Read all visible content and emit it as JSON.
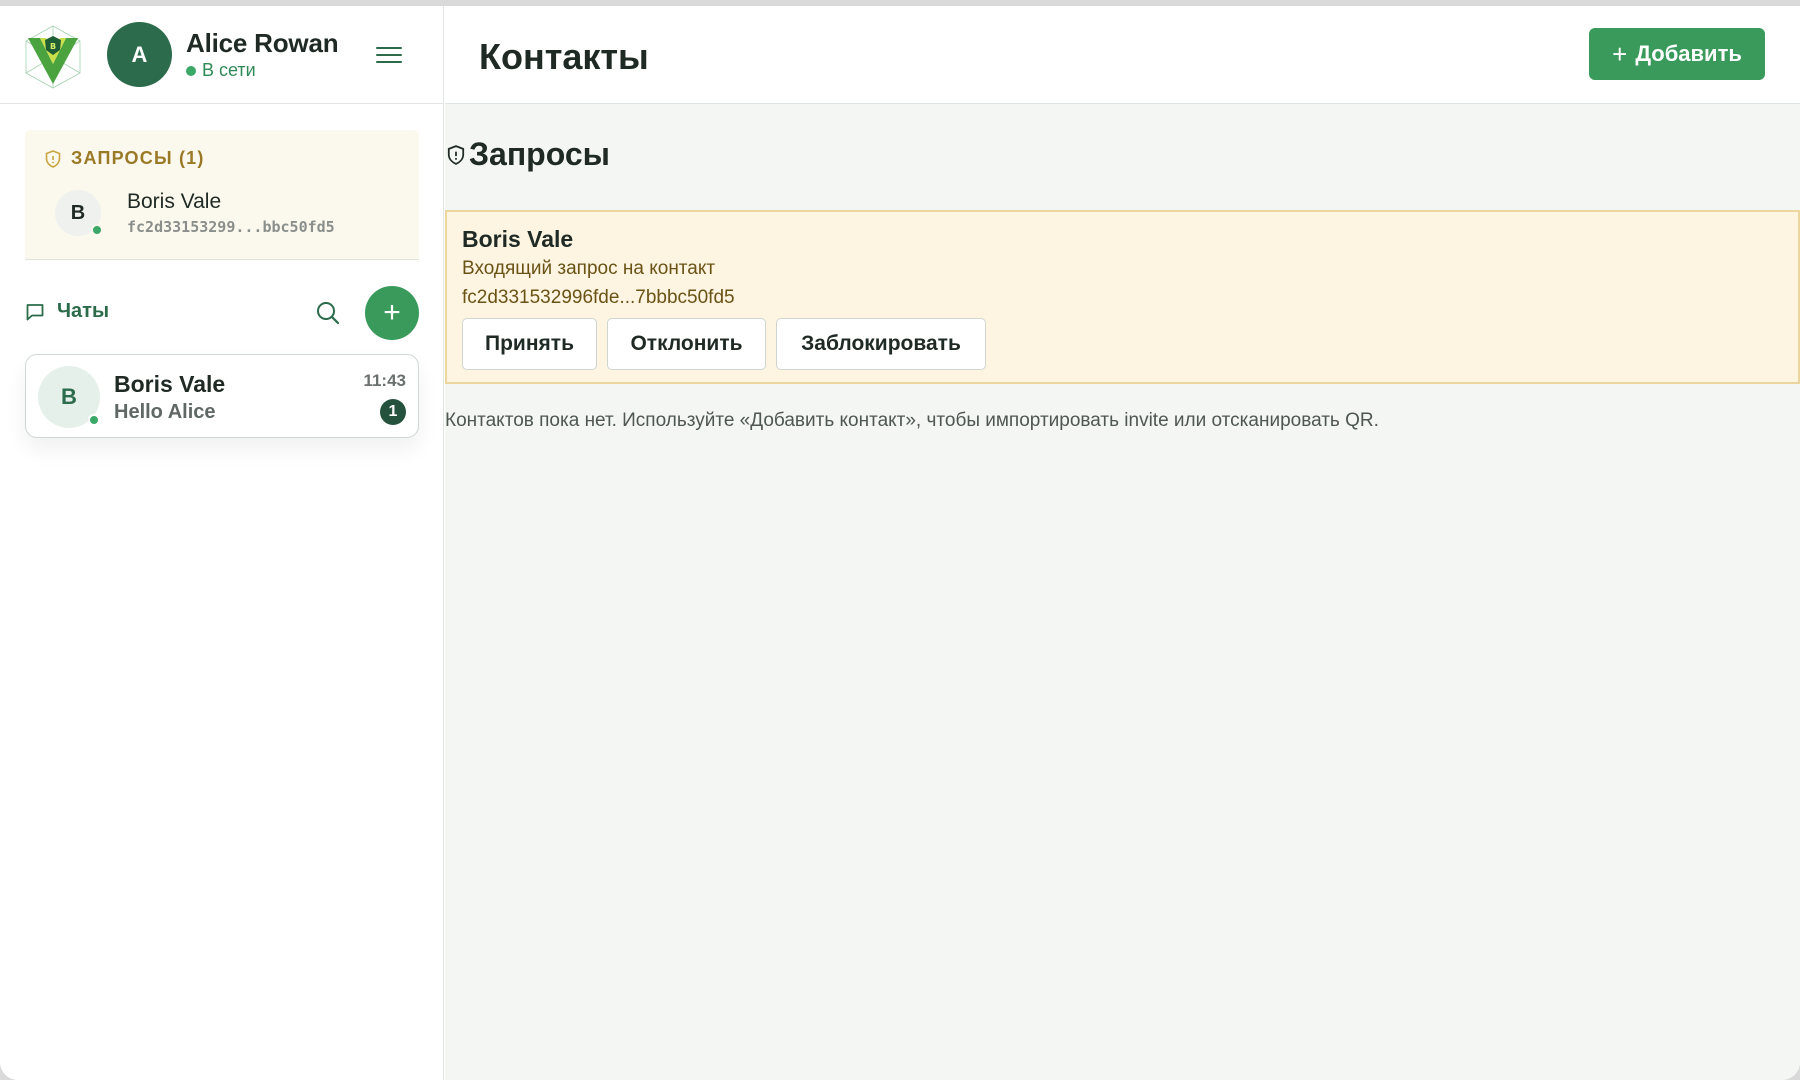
{
  "user": {
    "initial": "A",
    "name": "Alice Rowan",
    "status": "В сети"
  },
  "requests_panel": {
    "title": "ЗАПРОСЫ (1)",
    "items": [
      {
        "initial": "B",
        "name": "Boris Vale",
        "id": "fc2d33153299...bbc50fd5"
      }
    ]
  },
  "chats": {
    "title": "Чаты",
    "items": [
      {
        "initial": "B",
        "name": "Boris Vale",
        "preview": "Hello Alice",
        "time": "11:43",
        "unread": "1"
      }
    ]
  },
  "main": {
    "title": "Контакты",
    "add_label": "Добавить",
    "section_title": "Запросы",
    "request_card": {
      "name": "Boris Vale",
      "subtitle": "Входящий запрос на контакт",
      "id": "fc2d331532996fde...7bbbc50fd5",
      "accept_label": "Принять",
      "decline_label": "Отклонить",
      "block_label": "Заблокировать"
    },
    "empty_note": "Контактов пока нет. Используйте «Добавить контакт», чтобы импортировать invite или отсканировать QR."
  },
  "colors": {
    "brand": "#3a9a5b",
    "brand_dark": "#2c6b4c",
    "online": "#3aa866",
    "request_bg": "#fdf5e2",
    "request_border": "#ecd6a0"
  },
  "icons": [
    "app-logo-icon",
    "online-dot-icon",
    "menu-icon",
    "shield-icon",
    "chat-bubble-icon",
    "search-icon",
    "plus-icon"
  ]
}
